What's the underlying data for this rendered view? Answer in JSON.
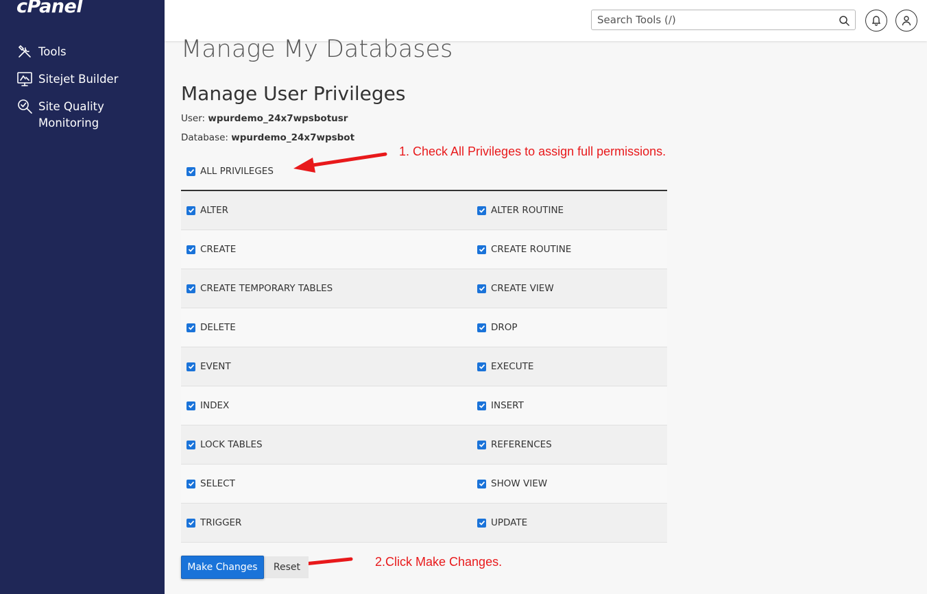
{
  "brand": {
    "logo": "cPanel"
  },
  "sidebar": {
    "items": [
      {
        "label": "Tools",
        "icon": "tools-icon"
      },
      {
        "label": "Sitejet Builder",
        "icon": "sitejet-builder-icon"
      },
      {
        "label": "Site Quality Monitoring",
        "icon": "site-quality-monitoring-icon"
      }
    ]
  },
  "header": {
    "search_placeholder": "Search Tools (/)",
    "search_icon": "search-icon",
    "notifications_icon": "bell-icon",
    "user_icon": "user-icon"
  },
  "page": {
    "title": "Manage My Databases",
    "section_title": "Manage User Privileges",
    "user_label": "User:",
    "user_value": "wpurdemo_24x7wpsbotusr",
    "database_label": "Database:",
    "database_value": "wpurdemo_24x7wpsbot"
  },
  "privileges": {
    "all_label": "ALL PRIVILEGES",
    "all_checked": true,
    "rows": [
      {
        "left": "ALTER",
        "right": "ALTER ROUTINE"
      },
      {
        "left": "CREATE",
        "right": "CREATE ROUTINE"
      },
      {
        "left": "CREATE TEMPORARY TABLES",
        "right": "CREATE VIEW"
      },
      {
        "left": "DELETE",
        "right": "DROP"
      },
      {
        "left": "EVENT",
        "right": "EXECUTE"
      },
      {
        "left": "INDEX",
        "right": "INSERT"
      },
      {
        "left": "LOCK TABLES",
        "right": "REFERENCES"
      },
      {
        "left": "SELECT",
        "right": "SHOW VIEW"
      },
      {
        "left": "TRIGGER",
        "right": "UPDATE"
      }
    ],
    "all_items_checked": true
  },
  "actions": {
    "make_changes": "Make Changes",
    "reset": "Reset"
  },
  "annotations": {
    "step1": "1. Check All Privileges to assign full permissions.",
    "step2": "2.Click Make Changes."
  },
  "colors": {
    "sidebar_bg": "#1f2757",
    "primary": "#1a73d9",
    "annotation": "#e8191b"
  }
}
